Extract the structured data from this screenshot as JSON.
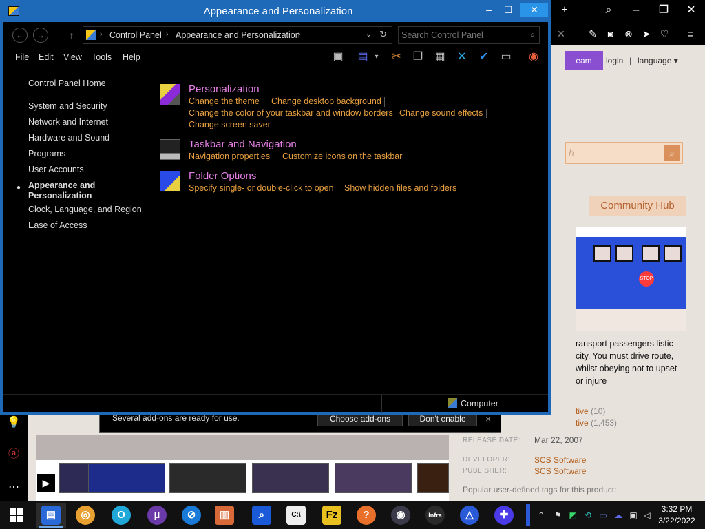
{
  "browser": {
    "titlebar_buttons": [
      "+",
      "search",
      "–",
      "restore",
      "×"
    ],
    "web": {
      "nav": {
        "team": "eam",
        "login": "login",
        "separator": "|",
        "language": "language"
      },
      "search_placeholder": "h",
      "community_hub": "Community Hub",
      "description": "ransport passengers listic city. You must drive route, whilst obeying not to upset or injure",
      "reviews": [
        {
          "value": "tive",
          "count": "(10)"
        },
        {
          "value": "tive",
          "count": "(1,453)"
        }
      ],
      "meta": {
        "release_label": "RELEASE DATE:",
        "release_date": "Mar 22, 2007",
        "developer_label": "DEVELOPER:",
        "developer": "SCS Software",
        "publisher_label": "PUBLISHER:",
        "publisher": "SCS Software"
      },
      "tags_label": "Popular user-defined tags for this product:",
      "stop_sign": "STOP"
    },
    "addon_bar": {
      "message": "Several add-ons are ready for use.",
      "choose": "Choose add-ons",
      "dont_enable": "Don't enable",
      "close": "×"
    }
  },
  "control_panel": {
    "title": "Appearance and Personalization",
    "window_buttons": {
      "minimize": "–",
      "maximize": "☐",
      "close": "✕"
    },
    "address": {
      "crumbs": [
        "Control Panel",
        "Appearance and Personalization"
      ],
      "search_placeholder": "Search Control Panel"
    },
    "menu": [
      "File",
      "Edit",
      "View",
      "Tools",
      "Help"
    ],
    "sidebar": {
      "home": "Control Panel Home",
      "items": [
        "System and Security",
        "Network and Internet",
        "Hardware and Sound",
        "Programs",
        "User Accounts",
        "Appearance and Personalization",
        "Clock, Language, and Region",
        "Ease of Access"
      ]
    },
    "categories": [
      {
        "title": "Personalization",
        "links": [
          "Change the theme",
          "Change desktop background",
          "Change the color of your taskbar and window borders",
          "Change sound effects",
          "Change screen saver"
        ]
      },
      {
        "title": "Taskbar and Navigation",
        "links": [
          "Navigation properties",
          "Customize icons on the taskbar"
        ]
      },
      {
        "title": "Folder Options",
        "links": [
          "Specify single- or double-click to open",
          "Show hidden files and folders"
        ]
      }
    ],
    "status": "Computer"
  },
  "taskbar": {
    "clock_time": "3:32 PM",
    "clock_date": "3/22/2022"
  },
  "colors": {
    "window_border": "#1e6ab8",
    "category_title": "#e880e8",
    "task_link": "#e8a040",
    "web_link": "#b35f1c"
  }
}
